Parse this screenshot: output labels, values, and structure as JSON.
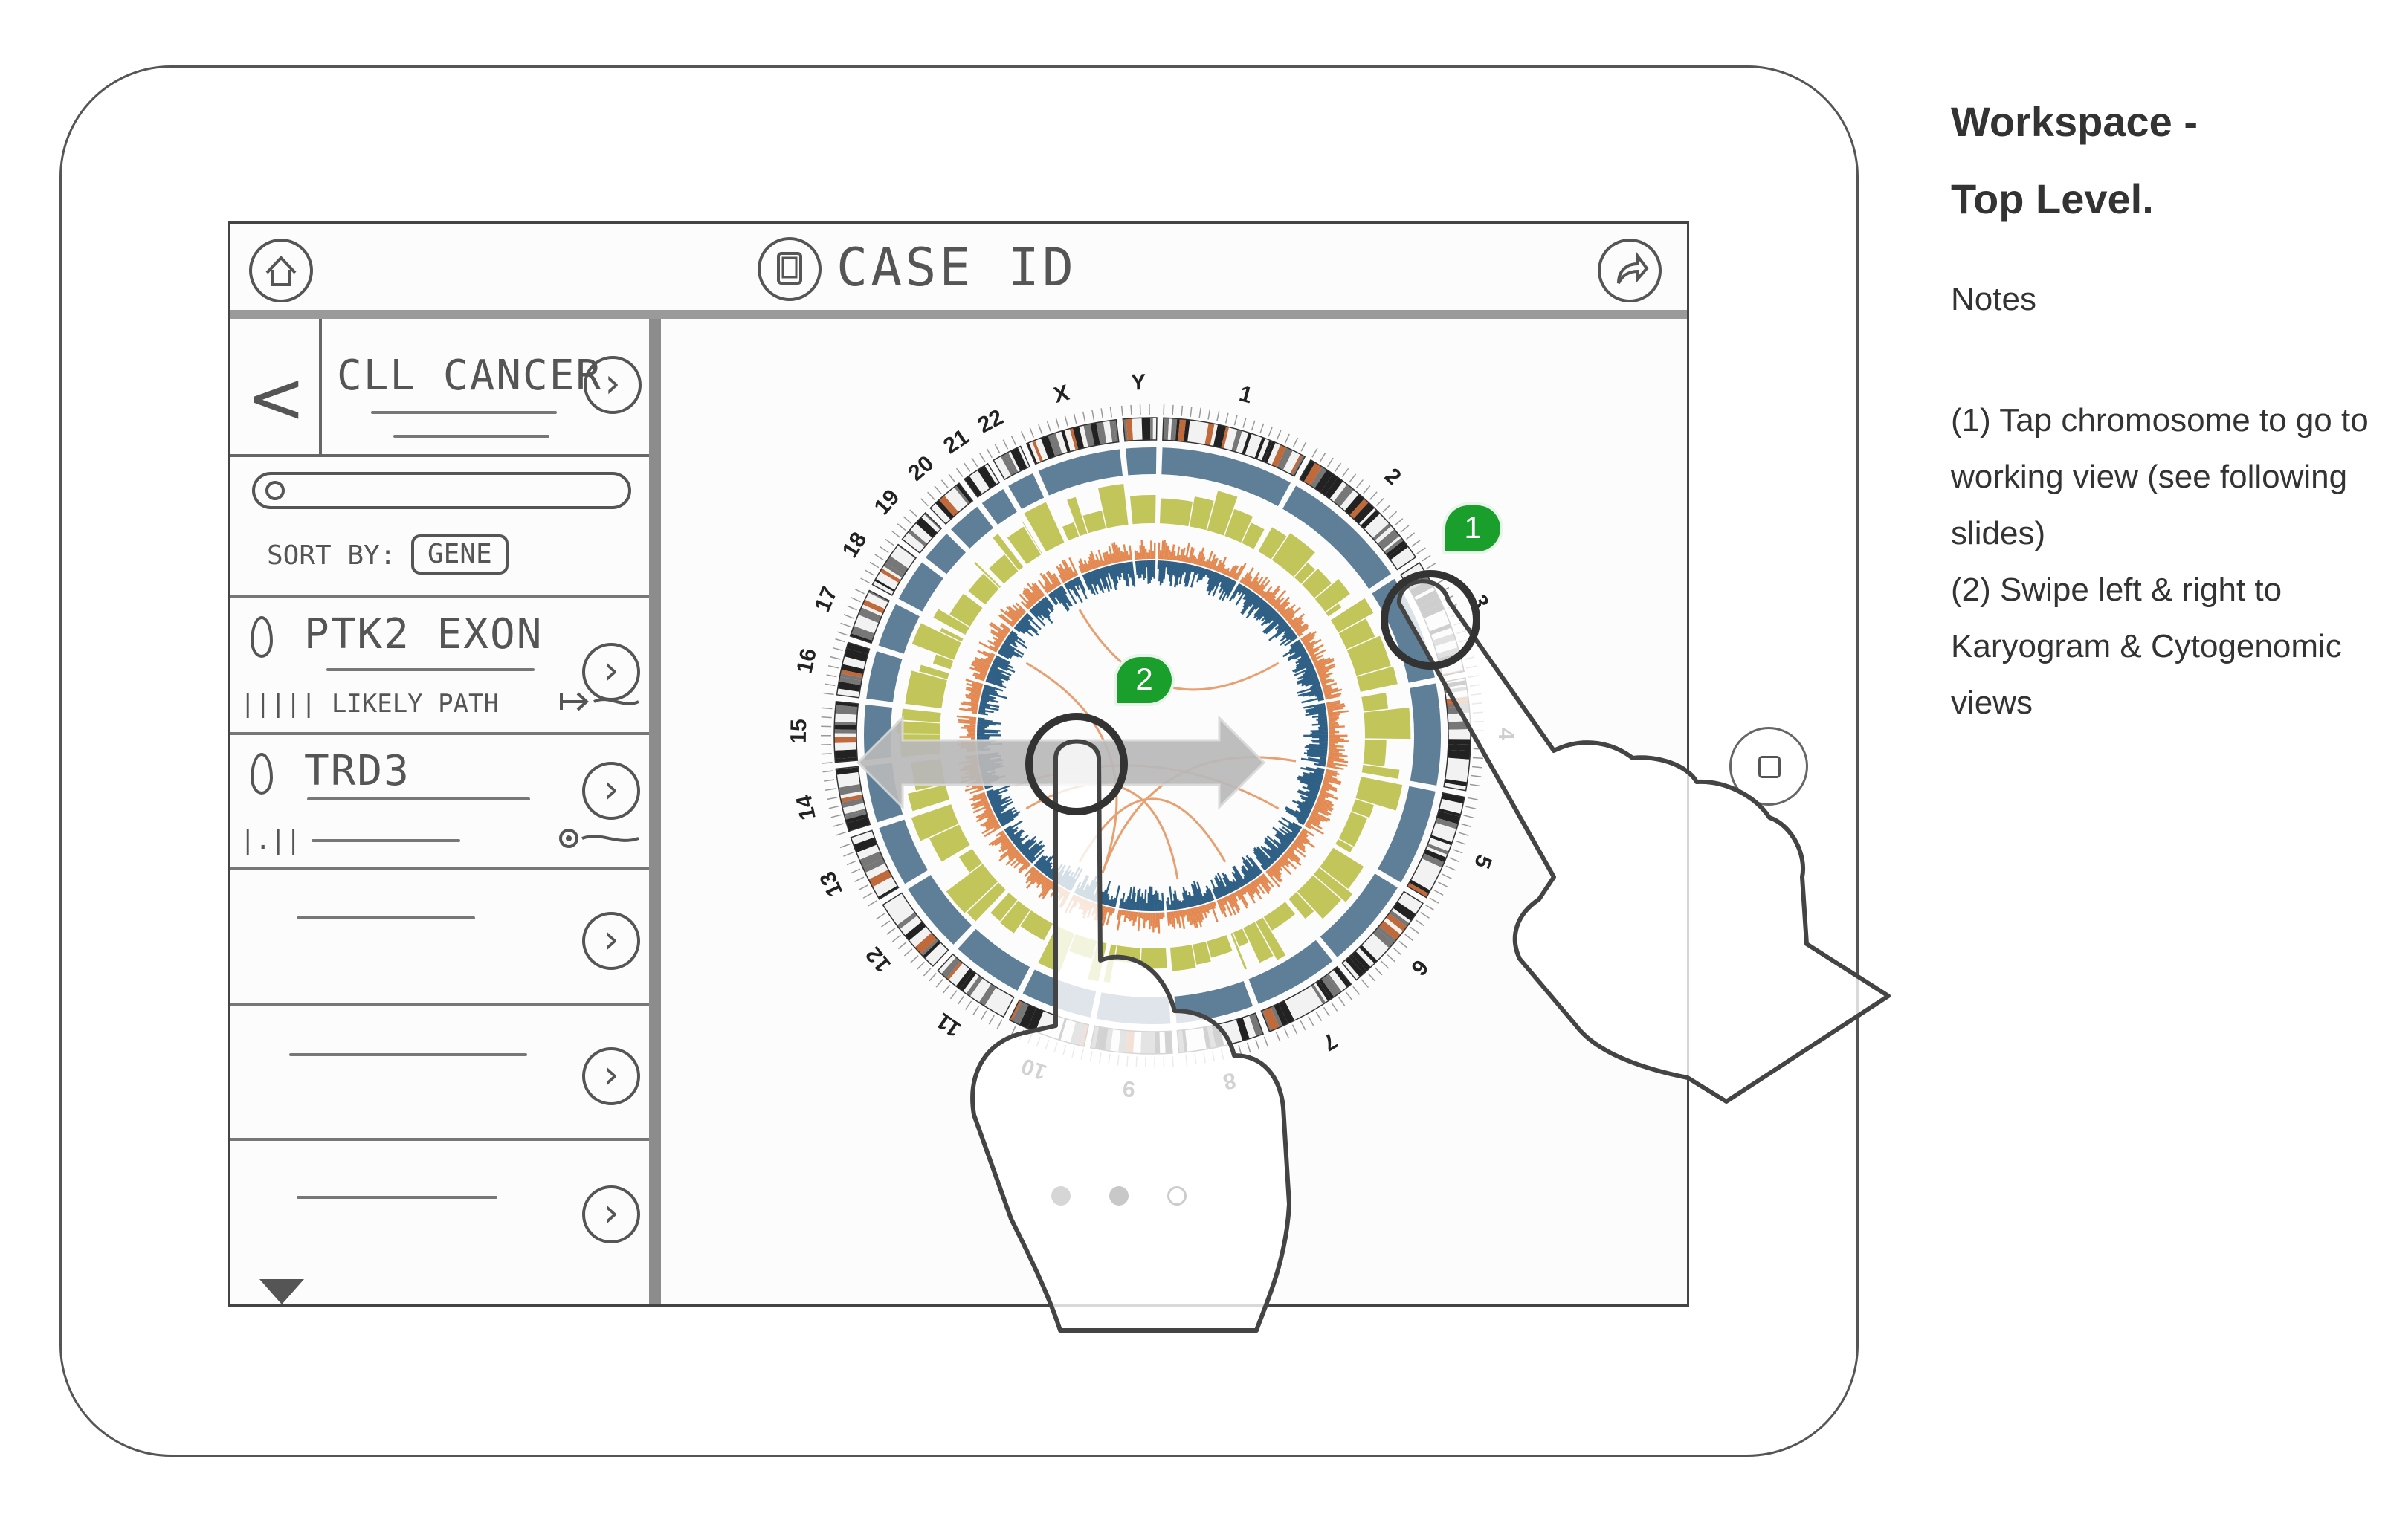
{
  "topbar": {
    "case_title": "CASE ID",
    "home_icon": "home-icon",
    "cases_icon": "folder-icon",
    "share_icon": "share-icon"
  },
  "sidebar": {
    "back_label": "<",
    "title": "CLL CANCER",
    "search_icon": "search-icon",
    "sort_label": "SORT BY:",
    "sort_value": "GENE",
    "items": [
      {
        "title": "PTK2 EXON",
        "subtitle": "||||| LIKELY PATH"
      },
      {
        "title": "TRD3",
        "subtitle": "|.||"
      }
    ]
  },
  "circos": {
    "chromosomes": [
      "1",
      "2",
      "3",
      "4",
      "5",
      "6",
      "7",
      "8",
      "9",
      "10",
      "11",
      "12",
      "13",
      "14",
      "15",
      "16",
      "17",
      "18",
      "19",
      "20",
      "21",
      "22",
      "X",
      "Y"
    ],
    "ring_colors": {
      "ideogram": "#222222",
      "cnv": "#5f7f98",
      "loh": "#c2c55a",
      "snv_orange": "#e38850",
      "snv_blue": "#2f5f85",
      "links": "#e8a070"
    }
  },
  "callouts": [
    {
      "number": "1",
      "color": "#1a9e2c"
    },
    {
      "number": "2",
      "color": "#1a9e2c"
    }
  ],
  "page_indicator": {
    "count": 3,
    "active": 2
  },
  "panel": {
    "title_line1": "Workspace -",
    "title_line2": "Top Level.",
    "notes_heading": "Notes",
    "notes": [
      "(1) Tap chromosome to go to working view (see following slides)",
      "(2) Swipe left & right to Karyogram & Cytogenomic views"
    ]
  }
}
